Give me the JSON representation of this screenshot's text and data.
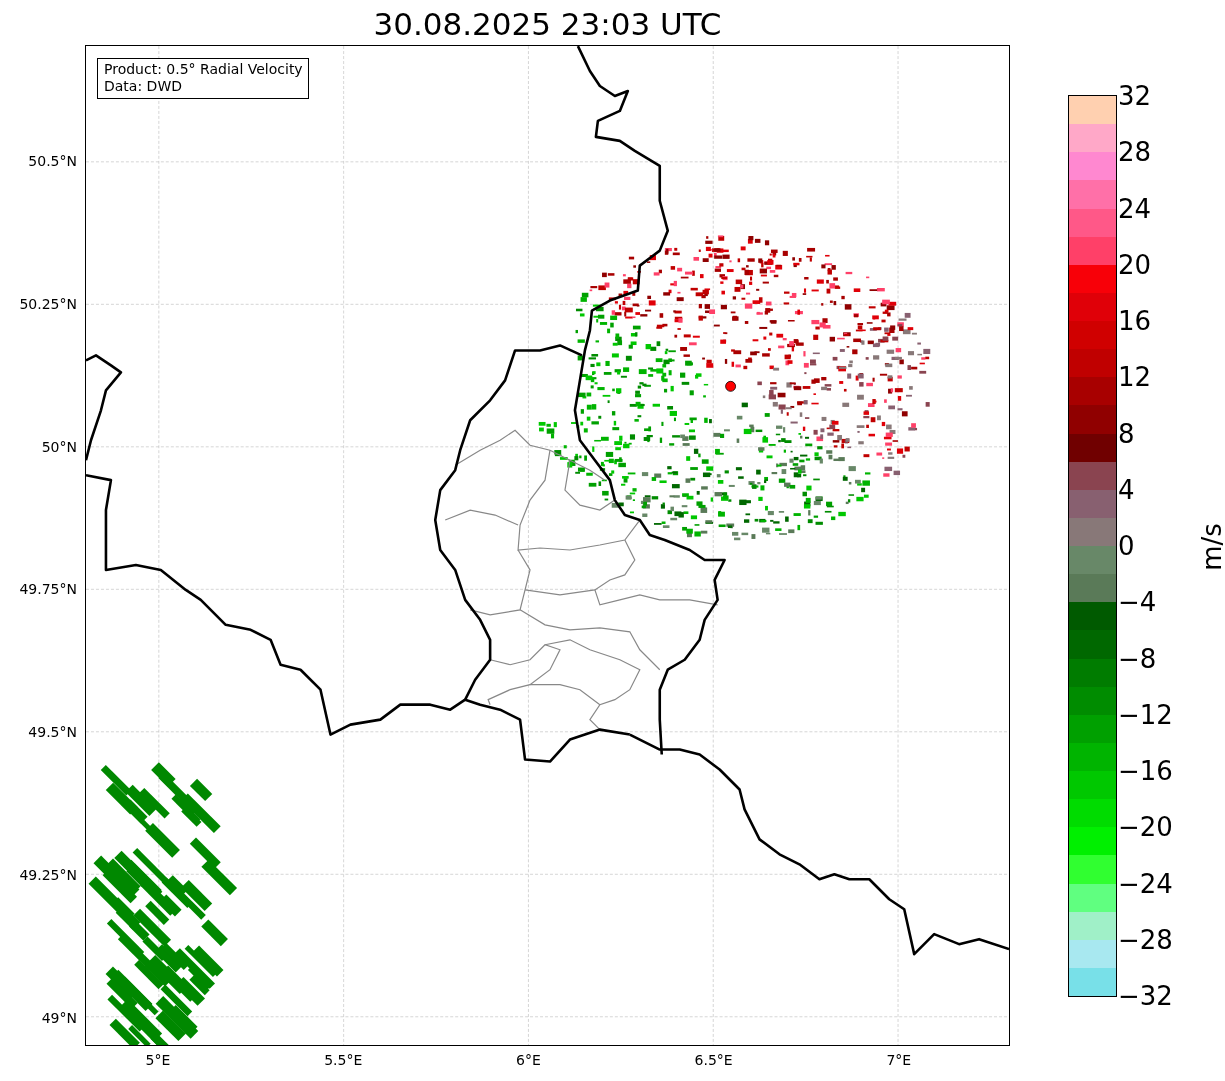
{
  "title": "30.08.2025 23:03 UTC",
  "info_box": {
    "lines": [
      "Product: 0.5° Radial Velocity",
      "Data: DWD"
    ]
  },
  "lat_ticks": [
    "50.5°N",
    "50.25°N",
    "50°N",
    "49.75°N",
    "49.5°N",
    "49.25°N",
    "49°N"
  ],
  "lon_ticks": [
    "5°E",
    "5.5°E",
    "6°E",
    "6.5°E",
    "7°E"
  ],
  "colorbar": {
    "label": "m/s",
    "ticks": [
      "32",
      "28",
      "24",
      "20",
      "16",
      "12",
      "8",
      "4",
      "0",
      "−4",
      "−8",
      "−12",
      "−16",
      "−20",
      "−24",
      "−28",
      "−32"
    ],
    "bins": [
      {
        "color": "#ffd0b0"
      },
      {
        "color": "#ffa8c8"
      },
      {
        "color": "#ff88d0"
      },
      {
        "color": "#ff70a8"
      },
      {
        "color": "#ff5888"
      },
      {
        "color": "#ff4068"
      },
      {
        "color": "#f80008"
      },
      {
        "color": "#e00008"
      },
      {
        "color": "#d00000"
      },
      {
        "color": "#c00000"
      },
      {
        "color": "#a80000"
      },
      {
        "color": "#900000"
      },
      {
        "color": "#700000"
      },
      {
        "color": "#8a4450"
      },
      {
        "color": "#886070"
      },
      {
        "color": "#887878"
      },
      {
        "color": "#688868"
      },
      {
        "color": "#5a7a58"
      },
      {
        "color": "#005a00"
      },
      {
        "color": "#006800"
      },
      {
        "color": "#007c00"
      },
      {
        "color": "#008c00"
      },
      {
        "color": "#00a000"
      },
      {
        "color": "#00b400"
      },
      {
        "color": "#00c800"
      },
      {
        "color": "#00dc00"
      },
      {
        "color": "#00f000"
      },
      {
        "color": "#30ff30"
      },
      {
        "color": "#60ff80"
      },
      {
        "color": "#a0f0c8"
      },
      {
        "color": "#a8e8f0"
      },
      {
        "color": "#78e0e8"
      }
    ]
  }
}
